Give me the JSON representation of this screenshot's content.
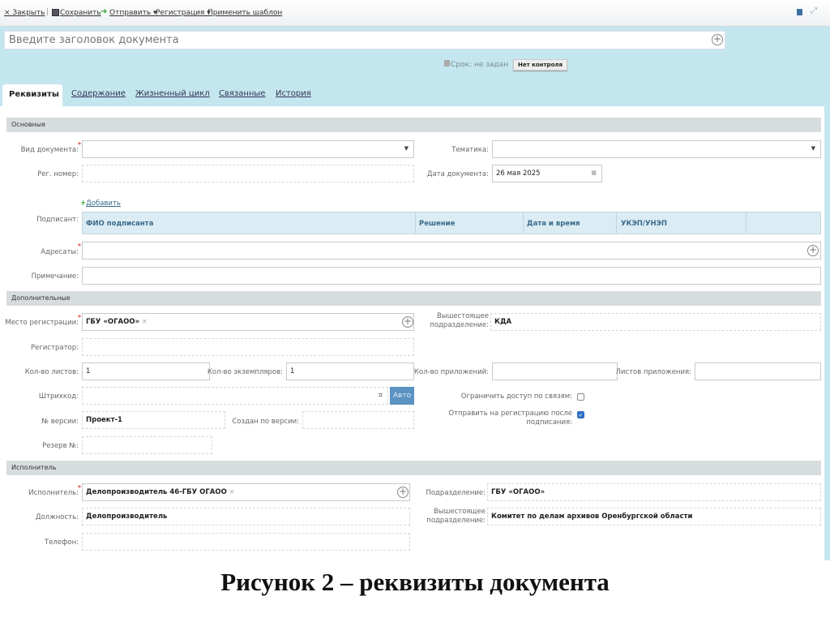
{
  "toolbar": {
    "close": "× Закрыть",
    "save": "Сохранить",
    "send": "Отправить ▾",
    "registration": "Регистрация ▾",
    "apply_template": "Применить шаблон"
  },
  "header": {
    "title_placeholder": "Введите заголовок документа",
    "deadline": "Срок: не задан",
    "no_control": "Нет контроля"
  },
  "tabs": [
    "Реквизиты",
    "Содержание",
    "Жизненный цикл",
    "Связанные",
    "История"
  ],
  "sections": {
    "main": "Основные",
    "extra": "Дополнительные",
    "executor": "Исполнитель"
  },
  "main": {
    "doc_type_label": "Вид документа:",
    "topic_label": "Тематика:",
    "reg_num_label": "Рег. номер:",
    "doc_date_label": "Дата документа:",
    "doc_date": "26 мая 2025",
    "add_link": "Добавить",
    "signer_label": "Подписант:",
    "signer_columns": [
      "ФИО подписанта",
      "Решение",
      "Дата и время",
      "УКЭП/УНЭП"
    ],
    "addressees_label": "Адресаты:",
    "note_label": "Примечание:"
  },
  "extra": {
    "reg_place_label": "Место регистрации:",
    "reg_place": "ГБУ «ОГАОО»",
    "parent_dept_label1": "Вышестоящее",
    "parent_dept_label2": "подразделение:",
    "parent_dept": "КДА",
    "registrar_label": "Регистратор:",
    "sheets_label": "Кол-во листов:",
    "sheets": "1",
    "copies_label": "Кол-во экземпляров:",
    "copies": "1",
    "attachments_label": "Кол-во приложений:",
    "attach_sheets_label": "Листов приложения:",
    "barcode_label": "Штрихкод:",
    "auto": "Авто",
    "restrict_label": "Ограничить доступ по связям:",
    "send_reg_label1": "Отправить на регистрацию после",
    "send_reg_label2": "подписания:",
    "version_label": "№ версии:",
    "version": "Проект-1",
    "created_from_label": "Создан по версии:",
    "reserve_label": "Резерв №:"
  },
  "executor": {
    "executor_label": "Исполнитель:",
    "executor": "Делопроизводитель 46-ГБУ ОГАОО",
    "dept_label": "Подразделение:",
    "dept": "ГБУ «ОГАОО»",
    "position_label": "Должность:",
    "position": "Делопроизводитель",
    "parent_label1": "Вышестоящее",
    "parent_label2": "подразделение:",
    "parent": "Комитет по делам архивов Оренбургской области",
    "phone_label": "Телефон:"
  },
  "caption": "Рисунок 2 – реквизиты документа"
}
